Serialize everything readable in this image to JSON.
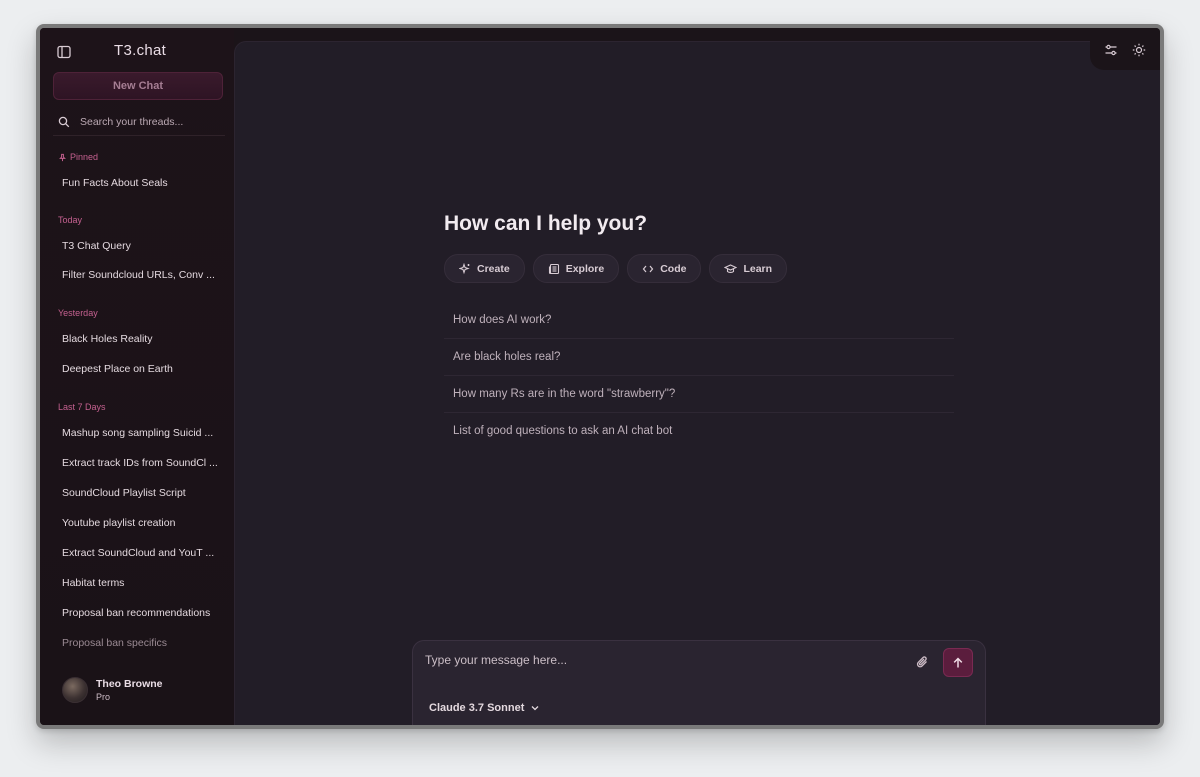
{
  "app": {
    "brand": "T3.chat"
  },
  "sidebar": {
    "new_chat_label": "New Chat",
    "search_placeholder": "Search your threads...",
    "groups": [
      {
        "label": "Pinned",
        "threads": [
          "Fun Facts About Seals"
        ]
      },
      {
        "label": "Today",
        "threads": [
          "T3 Chat Query",
          "Filter Soundcloud URLs, Conv ..."
        ]
      },
      {
        "label": "Yesterday",
        "threads": [
          "Black Holes Reality",
          "Deepest Place on Earth"
        ]
      },
      {
        "label": "Last 7 Days",
        "threads": [
          "Mashup song sampling Suicid ...",
          "Extract track IDs from SoundCl ...",
          "SoundCloud Playlist Script",
          "Youtube playlist creation",
          "Extract SoundCloud and YouT ...",
          "Habitat terms",
          "Proposal ban recommendations",
          "Proposal ban specifics"
        ]
      }
    ],
    "user": {
      "name": "Theo Browne",
      "plan": "Pro"
    }
  },
  "main": {
    "hero": "How can I help you?",
    "categories": [
      {
        "label": "Create",
        "icon": "sparkles-icon"
      },
      {
        "label": "Explore",
        "icon": "newspaper-icon"
      },
      {
        "label": "Code",
        "icon": "code-icon"
      },
      {
        "label": "Learn",
        "icon": "graduation-cap-icon"
      }
    ],
    "suggestions": [
      "How does AI work?",
      "Are black holes real?",
      "How many Rs are in the word \"strawberry\"?",
      "List of good questions to ask an AI chat bot"
    ]
  },
  "composer": {
    "placeholder": "Type your message here...",
    "model": "Claude 3.7 Sonnet"
  },
  "colors": {
    "accent": "#c4608f",
    "send_button": "#5b1d3d",
    "sidebar_bg": "#1b1419",
    "main_bg": "#221d27"
  }
}
